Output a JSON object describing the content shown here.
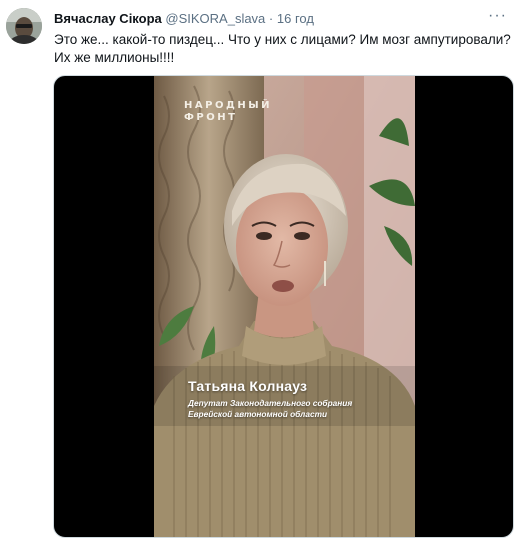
{
  "author": {
    "name": "Вячаслау Сікора",
    "handle": "@SIKORA_slava",
    "separator": "·",
    "time": "16 год"
  },
  "tweet": {
    "lines": [
      "Это же... какой-то пиздец... Что у них с лицами? Им мозг ампутировали?",
      "Их же миллионы!!!!"
    ]
  },
  "menu": {
    "icon": "more-options-icon",
    "glyph": "···"
  },
  "video": {
    "watermark_line1": "НАРОДНЫЙ",
    "watermark_line2": "ФРОНТ",
    "caption_name": "Татьяна Колнауз",
    "caption_title_line1": "Депутат Законодательного собрания",
    "caption_title_line2": "Еврейской автономной области"
  },
  "colors": {
    "text": "#0f1419",
    "secondary": "#5b7083",
    "media_letterbox": "#000000",
    "sweater": "#a08e6c"
  }
}
